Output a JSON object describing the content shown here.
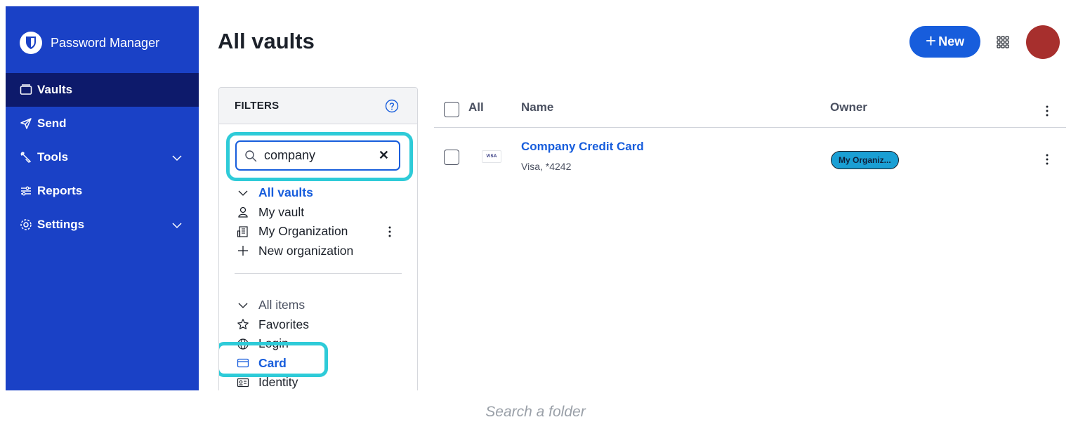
{
  "sidebar": {
    "brand": "Password Manager",
    "items": [
      {
        "label": "Vaults",
        "icon": "vault-icon"
      },
      {
        "label": "Send",
        "icon": "send-icon"
      },
      {
        "label": "Tools",
        "icon": "tools-icon"
      },
      {
        "label": "Reports",
        "icon": "reports-icon"
      },
      {
        "label": "Settings",
        "icon": "settings-icon"
      }
    ]
  },
  "header": {
    "title": "All vaults",
    "new_button": "New"
  },
  "filters": {
    "title": "FILTERS",
    "search_value": "company",
    "vaults": [
      {
        "label": "All vaults"
      },
      {
        "label": "My vault"
      },
      {
        "label": "My Organization"
      },
      {
        "label": "New organization"
      }
    ],
    "types": [
      {
        "label": "All items"
      },
      {
        "label": "Favorites"
      },
      {
        "label": "Login"
      },
      {
        "label": "Card"
      },
      {
        "label": "Identity"
      }
    ]
  },
  "table": {
    "headers": {
      "all": "All",
      "name": "Name",
      "owner": "Owner"
    },
    "rows": [
      {
        "icon": "VISA",
        "name": "Company Credit Card",
        "subtitle": "Visa, *4242",
        "owner": "My Organiz..."
      }
    ]
  },
  "caption": "Search a folder",
  "colors": {
    "sidebar": "#1a41c6",
    "sidebar_active": "#0d1a6b",
    "accent": "#175ddc",
    "highlight": "#2ecbd8",
    "avatar": "#a72f2d",
    "owner_badge": "#1a9fd4"
  }
}
